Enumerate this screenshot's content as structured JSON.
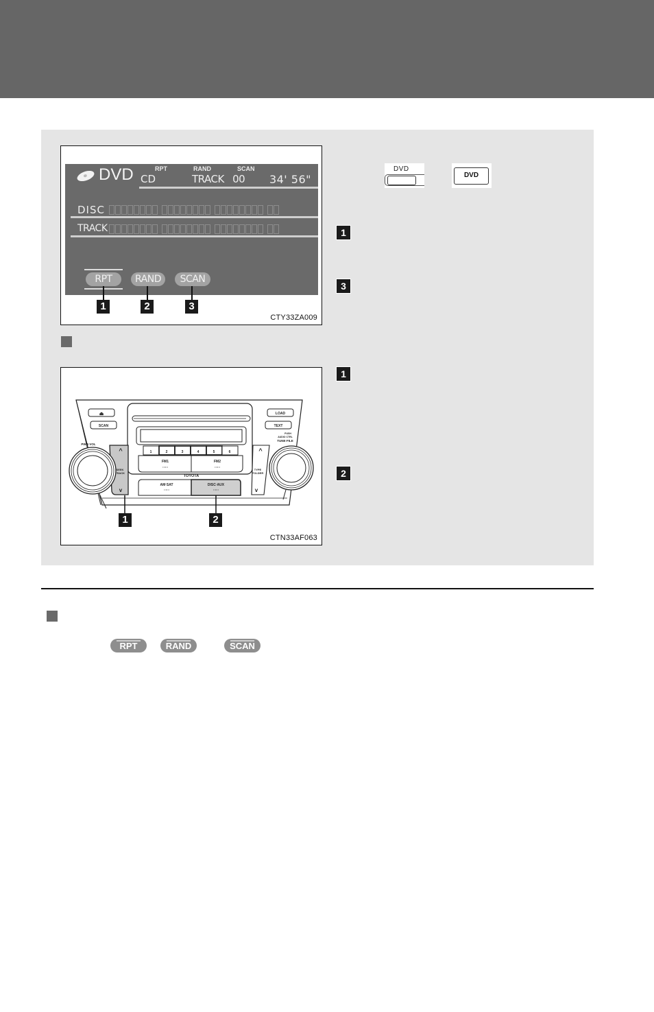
{
  "page": {
    "header_bar_color": "#666666",
    "panel_color": "#e5e5e5"
  },
  "figure1": {
    "code": "CTY33ZA009",
    "screen": {
      "mode": "DVD",
      "source": "CD",
      "indicators": {
        "rpt": "RPT",
        "rand": "RAND",
        "scan": "SCAN"
      },
      "track_label": "TRACK",
      "track_number": "00",
      "time": "34' 56\"",
      "rows": {
        "disc": "DISC",
        "track": "TRACK"
      },
      "buttons": {
        "rpt": "RPT",
        "rand": "RAND",
        "scan": "SCAN"
      }
    },
    "callouts": [
      "1",
      "2",
      "3"
    ]
  },
  "dvd_buttons": {
    "button_a_label": "DVD",
    "button_b_label": "DVD"
  },
  "side_callouts_top": [
    "1",
    "3"
  ],
  "figure2": {
    "code": "CTN33AF063",
    "radio": {
      "eject_symbol": "⏏",
      "scan": "SCAN",
      "load": "LOAD",
      "text": "TEXT",
      "pwr_vol": "PWR·VOL",
      "seek_track": [
        "SEEK",
        "TRACK"
      ],
      "type_folder": [
        "TYPE",
        "FOLDER"
      ],
      "tune_file": [
        "PUSH",
        "AUDIO CTRL",
        "TUNE·FILE"
      ],
      "presets": [
        "1",
        "2",
        "3",
        "4",
        "5",
        "6"
      ],
      "fm1": "FM1",
      "fm2": "FM2",
      "brand": "TOYOTA",
      "am_sat": "AM·SAT",
      "disc_aux": "DISC·AUX",
      "up_arrow": "^",
      "down_arrow": "v"
    },
    "callouts": [
      "1",
      "2"
    ]
  },
  "side_callouts_bottom": [
    "1",
    "2"
  ],
  "inline_buttons": {
    "rpt": "RPT",
    "rand": "RAND",
    "scan": "SCAN"
  }
}
